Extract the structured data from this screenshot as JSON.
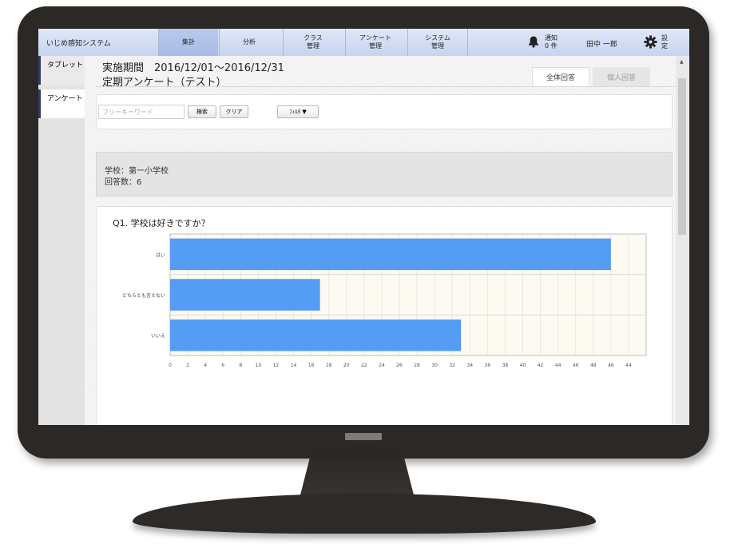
{
  "app": {
    "title": "いじめ感知システム"
  },
  "nav": {
    "tabs": [
      {
        "label": "集計",
        "active": true
      },
      {
        "label": "分析"
      },
      {
        "label": "クラス\n管理"
      },
      {
        "label": "アンケート\n管理"
      },
      {
        "label": "システム\n管理"
      }
    ],
    "notifications": "通知\n0 件",
    "user": "田中 一郎",
    "settings": "設\n定",
    "icons": {
      "bell": "bell-icon",
      "gear": "gear-icon"
    }
  },
  "sidebar": {
    "items": [
      {
        "label": "タブレット"
      },
      {
        "label": "アンケート",
        "active": true
      }
    ]
  },
  "header": {
    "period": "実施期間　2016/12/01～2016/12/31",
    "survey": "定期アンケート（テスト）",
    "tabs": {
      "all": "全体回答",
      "individual": "個人回答"
    }
  },
  "search": {
    "placeholder": "フリーキーワード",
    "search_label": "検索",
    "clear_label": "クリア",
    "filter_label": "ﾌｨﾙﾀ ▼"
  },
  "info": {
    "school": "学校：第一小学校",
    "count": "回答数：6"
  },
  "question": {
    "text": "Q1. 学校は好きですか？"
  },
  "colors": {
    "bar": "#559cf5",
    "nav_bg": "#d3def4",
    "sidebar_accent": "#333a66"
  },
  "chart_data": {
    "type": "bar",
    "orientation": "horizontal",
    "categories": [
      "はい",
      "どちらとも言えない",
      "いいえ"
    ],
    "values": [
      50,
      17,
      33
    ],
    "xticks": [
      "0",
      "2",
      "4",
      "6",
      "8",
      "10",
      "12",
      "14",
      "16",
      "18",
      "20",
      "22",
      "24",
      "26",
      "28",
      "30",
      "32",
      "34",
      "36",
      "38",
      "40",
      "42",
      "44",
      "46",
      "48",
      "46",
      "44"
    ],
    "xlim": [
      0,
      54
    ],
    "grid": true
  }
}
